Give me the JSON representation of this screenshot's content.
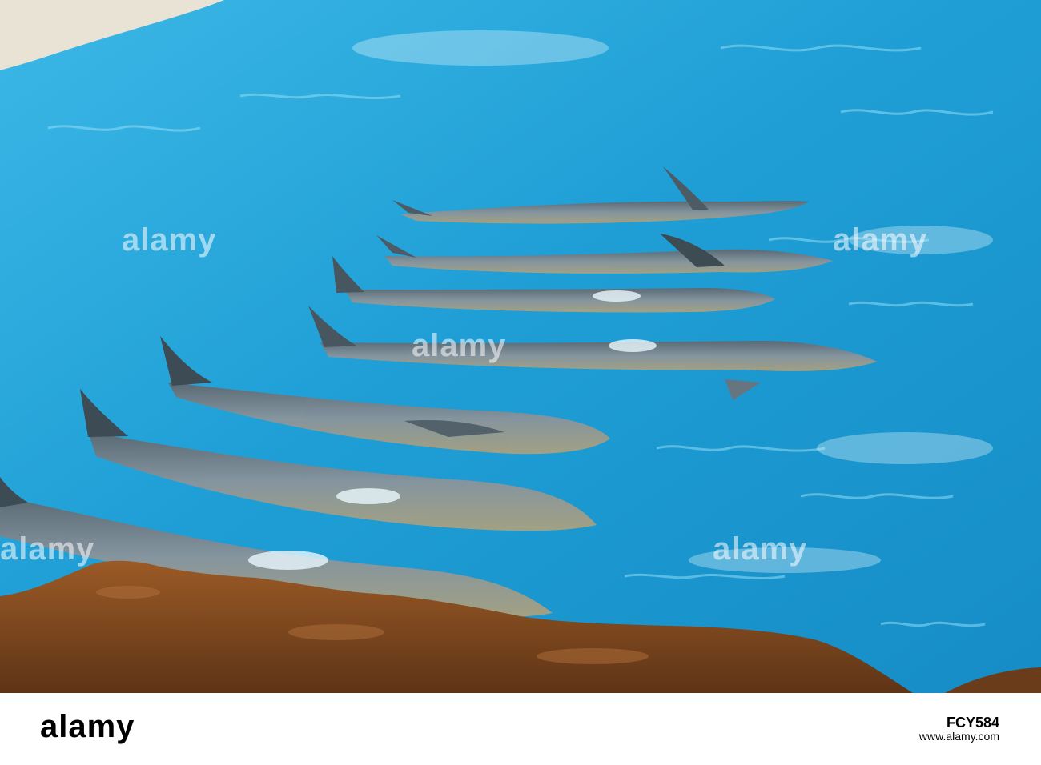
{
  "image": {
    "subject": "dolphin-pool-photo",
    "colors": {
      "water": "#2aa4d6",
      "water_light": "#6fd0f0",
      "rock": "#8a4f22",
      "dolphin": "#7f8a93"
    }
  },
  "watermark": {
    "text": "alamy"
  },
  "footer": {
    "brand": "alamy",
    "image_id": "FCY584",
    "site": "www.alamy.com"
  }
}
